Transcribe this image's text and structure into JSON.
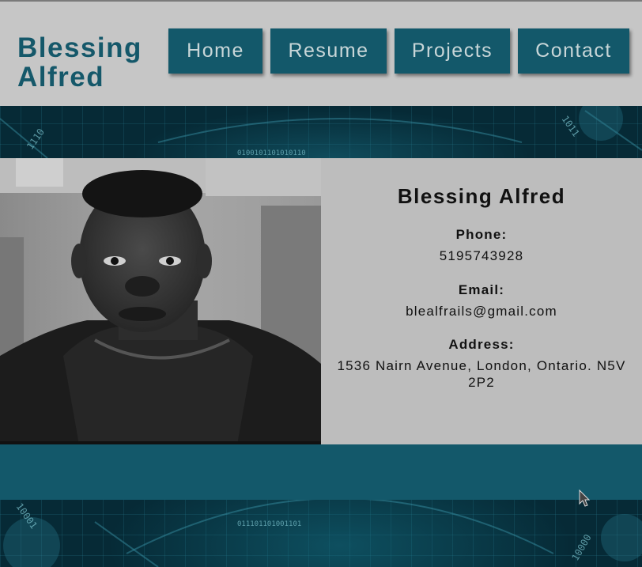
{
  "site": {
    "brand": "Blessing Alfred"
  },
  "nav": {
    "items": [
      "Home",
      "Resume",
      "Projects",
      "Contact"
    ]
  },
  "profile": {
    "photo_alt": "Portrait photo",
    "name": "Blessing Alfred",
    "phone_label": "Phone:",
    "phone": "5195743928",
    "email_label": "Email:",
    "email": "blealfrails@gmail.com",
    "address_label": "Address:",
    "address": "1536 Nairn Avenue, London, Ontario. N5V 2P2"
  },
  "colors": {
    "accent": "#13586a",
    "header_bg": "#c6c6c6",
    "info_bg": "#bdbdbd"
  }
}
